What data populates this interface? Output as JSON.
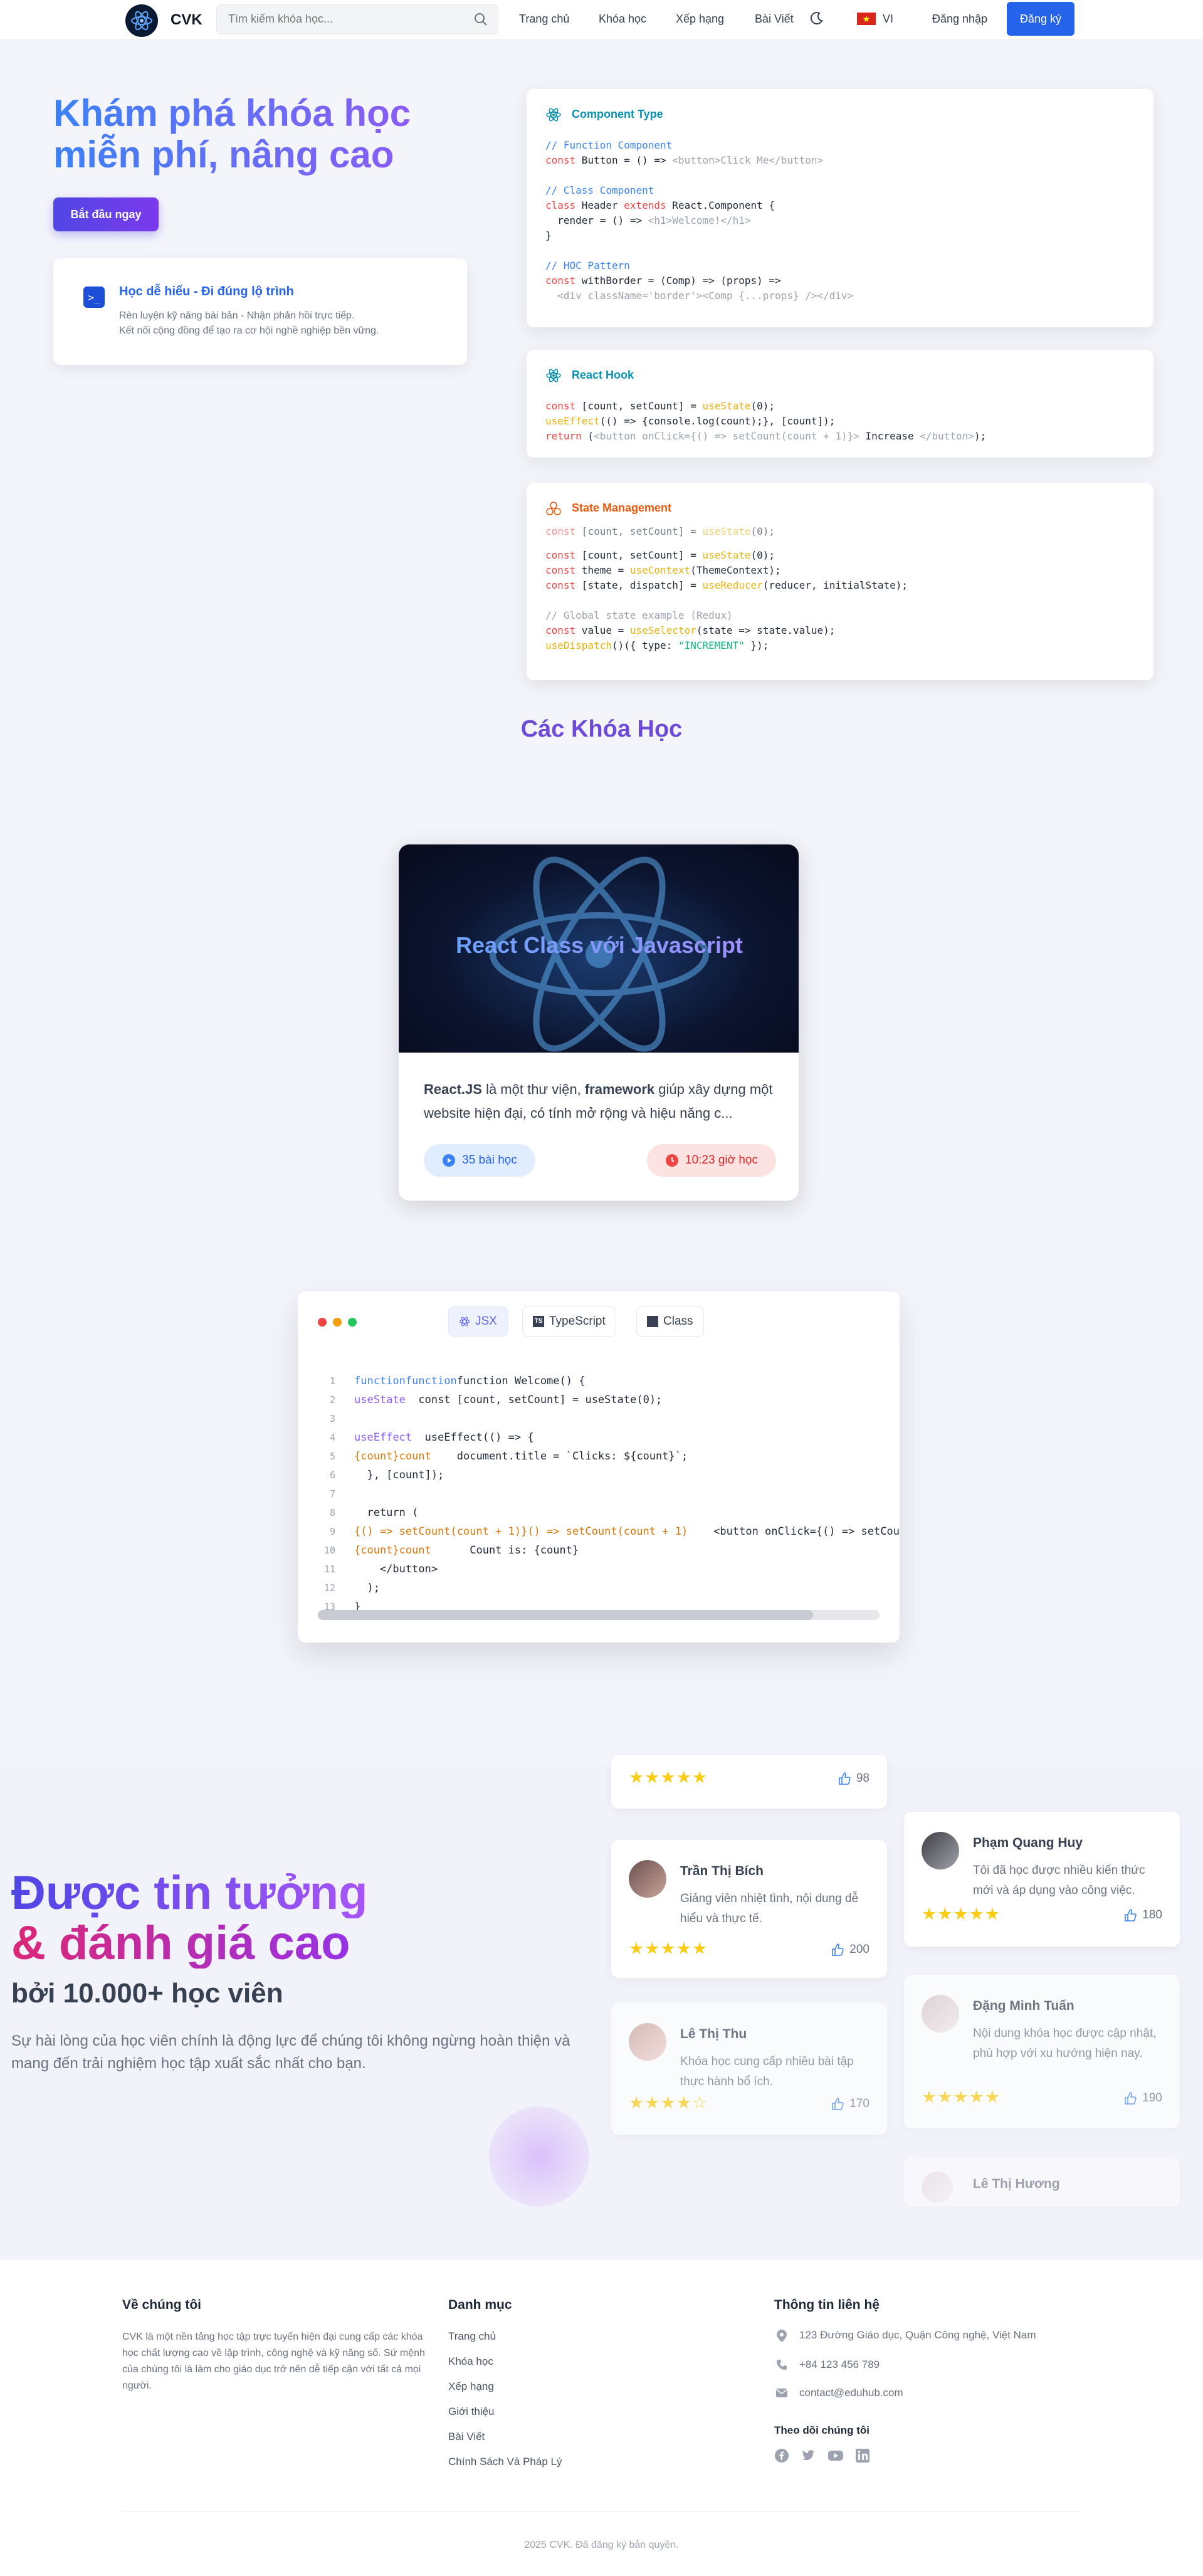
{
  "header": {
    "logo_text": "CVK",
    "search_placeholder": "Tìm kiếm khóa học...",
    "nav": [
      "Trang chủ",
      "Khóa học",
      "Xếp hạng",
      "Bài Viết"
    ],
    "language": "VI",
    "login": "Đăng nhập",
    "register": "Đăng ký"
  },
  "hero": {
    "title_line1": "Khám phá khóa học",
    "title_line2": "miễn phí, nâng cao",
    "cta": "Bắt đầu ngay",
    "feature_title": "Học dễ hiểu - Đi đúng lộ trình",
    "feature_desc_1": "Rèn luyện kỹ năng bài bản - Nhận phản hồi trực tiếp.",
    "feature_desc_2": "Kết nối cộng đồng để tạo ra cơ hội nghề nghiệp bền vững."
  },
  "code_cards": [
    {
      "title": "Component Type",
      "color": "#0891b2"
    },
    {
      "title": "React Hook",
      "color": "#0891b2"
    },
    {
      "title": "State Management",
      "color": "#ea580c"
    }
  ],
  "courses": {
    "section_title": "Các Khóa Học",
    "card": {
      "image_title": "React Class với Javascript",
      "desc_bold1": "React.JS",
      "desc_mid": " là một thư viện, ",
      "desc_bold2": "framework",
      "desc_rest": " giúp xây dựng một website hiện đại, có tính mở rộng và hiệu năng c...",
      "lessons": "35 bài học",
      "duration": "10:23 giờ học"
    }
  },
  "editor": {
    "tabs": [
      "JSX",
      "TypeScript",
      "Class"
    ],
    "line_numbers": [
      "1",
      "2",
      "3",
      "4",
      "5",
      "6",
      "7",
      "8",
      "9",
      "10",
      "11",
      "12",
      "13"
    ]
  },
  "trust": {
    "title_line1": "Được tin tưởng",
    "title_line2": "& đánh giá cao",
    "subtitle": "bởi 10.000+ học viên",
    "paragraph": "Sự hài lòng của học viên chính là động lực để chúng tôi không ngừng hoàn thiện và mang đến trải nghiệm học tập xuất sắc nhất cho bạn.",
    "reviews": [
      {
        "name": "",
        "text": "",
        "stars": "★★★★★",
        "likes": "98"
      },
      {
        "name": "Trần Thị Bích",
        "text": "Giảng viên nhiệt tình, nội dung dễ hiểu và thực tế.",
        "stars": "★★★★★",
        "likes": "200"
      },
      {
        "name": "Phạm Quang Huy",
        "text": "Tôi đã học được nhiều kiến thức mới và áp dụng vào công việc.",
        "stars": "★★★★★",
        "likes": "180"
      },
      {
        "name": "Lê Thị Thu",
        "text": "Khóa học cung cấp nhiều bài tập thực hành bổ ích.",
        "stars": "★★★★☆",
        "likes": "170"
      },
      {
        "name": "Đặng Minh Tuấn",
        "text": "Nội dung khóa học được cập nhật, phù hợp với xu hướng hiện nay.",
        "stars": "★★★★★",
        "likes": "190"
      },
      {
        "name": "Lê Thị Hương",
        "text": "",
        "stars": "",
        "likes": ""
      }
    ]
  },
  "footer": {
    "about_title": "Về chúng tôi",
    "about_text": "CVK là một nền tảng học tập trực tuyến hiện đại cung cấp các khóa học chất lượng cao về lập trình, công nghệ và kỹ năng số. Sứ mệnh của chúng tôi là làm cho giáo dục trở nên dễ tiếp cận với tất cả mọi người.",
    "menu_title": "Danh mục",
    "menu": [
      "Trang chủ",
      "Khóa học",
      "Xếp hạng",
      "Giới thiệu",
      "Bài Viết",
      "Chính Sách Và Pháp Lý"
    ],
    "contact_title": "Thông tin liên hệ",
    "address": "123 Đường Giáo dục, Quận Công nghệ, Việt Nam",
    "phone": "+84 123 456 789",
    "email": "contact@eduhub.com",
    "follow_title": "Theo dõi chúng tôi",
    "copyright": "2025 CVK. Đã đăng ký bản quyền."
  },
  "colors": {
    "primary": "#2563eb",
    "accent": "#7c3aed",
    "star": "#facc15"
  }
}
